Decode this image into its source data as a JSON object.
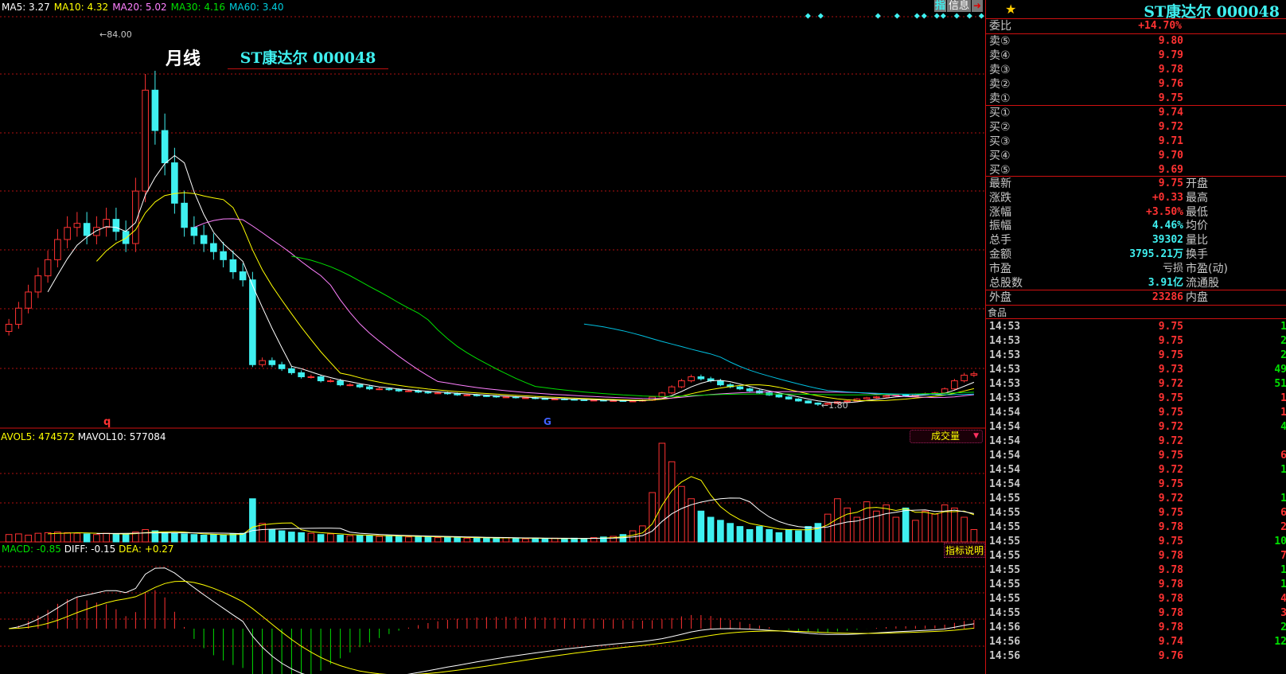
{
  "header": {
    "ma_labels": [
      {
        "text": "MA5: 3.27",
        "color": "#ffffff"
      },
      {
        "text": "MA10: 4.32",
        "color": "#ffff00"
      },
      {
        "text": "MA20: 5.02",
        "color": "#ff80ff"
      },
      {
        "text": "MA30: 4.16",
        "color": "#00e000"
      },
      {
        "text": "MA60: 3.40",
        "color": "#00d0e0"
      }
    ],
    "btn_zhi": "指",
    "btn_info": "信息"
  },
  "chart_title": {
    "period": "月线",
    "stock": "ST康达尔 000048"
  },
  "high_label": "84.00",
  "low_label": "1.80",
  "marker_q": "q",
  "marker_g": "G",
  "volume": {
    "avol5": "AVOL5: 474572",
    "mavol10": "MAVOL10: 577084",
    "selector": "成交量"
  },
  "macd": {
    "macd": "MACD: -0.85",
    "diff": "DIFF: -0.15",
    "dea": "DEA: +0.27",
    "help": "指标说明"
  },
  "quote": {
    "title": "ST康达尔 000048",
    "weibi": {
      "label": "委比",
      "value": "+14.70%"
    },
    "sell": [
      {
        "label": "卖⑤",
        "value": "9.80"
      },
      {
        "label": "卖④",
        "value": "9.79"
      },
      {
        "label": "卖③",
        "value": "9.78"
      },
      {
        "label": "卖②",
        "value": "9.76"
      },
      {
        "label": "卖①",
        "value": "9.75"
      }
    ],
    "buy": [
      {
        "label": "买①",
        "value": "9.74"
      },
      {
        "label": "买②",
        "value": "9.72"
      },
      {
        "label": "买③",
        "value": "9.71"
      },
      {
        "label": "买④",
        "value": "9.70"
      },
      {
        "label": "买⑤",
        "value": "9.69"
      }
    ],
    "stats": [
      {
        "label": "最新",
        "value": "9.75",
        "color": "red",
        "label2": "开盘"
      },
      {
        "label": "涨跌",
        "value": "+0.33",
        "color": "red",
        "label2": "最高"
      },
      {
        "label": "涨幅",
        "value": "+3.50%",
        "color": "red",
        "label2": "最低"
      },
      {
        "label": "振幅",
        "value": "4.46%",
        "color": "cyan",
        "label2": "均价"
      },
      {
        "label": "总手",
        "value": "39302",
        "color": "cyan",
        "label2": "量比"
      },
      {
        "label": "金额",
        "value": "3795.21万",
        "color": "cyan",
        "label2": "换手"
      },
      {
        "label": "市盈",
        "value": "亏损",
        "color": "grey",
        "label2": "市盈(动)"
      },
      {
        "label": "总股数",
        "value": "3.91亿",
        "color": "cyan",
        "label2": "流通股"
      }
    ],
    "outer": {
      "label": "外盘",
      "value": "23286",
      "label2": "内盘"
    },
    "sector": "食品",
    "ticks": [
      {
        "time": "14:53",
        "price": "9.75",
        "vol": "1",
        "c": "green"
      },
      {
        "time": "14:53",
        "price": "9.75",
        "vol": "2",
        "c": "green"
      },
      {
        "time": "14:53",
        "price": "9.75",
        "vol": "2",
        "c": "green"
      },
      {
        "time": "14:53",
        "price": "9.73",
        "vol": "49",
        "c": "green"
      },
      {
        "time": "14:53",
        "price": "9.72",
        "vol": "51",
        "c": "green"
      },
      {
        "time": "14:53",
        "price": "9.75",
        "vol": "1",
        "c": "red"
      },
      {
        "time": "14:54",
        "price": "9.75",
        "vol": "1",
        "c": "red"
      },
      {
        "time": "14:54",
        "price": "9.72",
        "vol": "4",
        "c": "green"
      },
      {
        "time": "14:54",
        "price": "9.72",
        "vol": "",
        "c": "green"
      },
      {
        "time": "14:54",
        "price": "9.75",
        "vol": "6",
        "c": "red"
      },
      {
        "time": "14:54",
        "price": "9.72",
        "vol": "1",
        "c": "green"
      },
      {
        "time": "14:54",
        "price": "9.75",
        "vol": "",
        "c": "red"
      },
      {
        "time": "14:55",
        "price": "9.72",
        "vol": "1",
        "c": "green"
      },
      {
        "time": "14:55",
        "price": "9.75",
        "vol": "6",
        "c": "red"
      },
      {
        "time": "14:55",
        "price": "9.78",
        "vol": "2",
        "c": "red"
      },
      {
        "time": "14:55",
        "price": "9.75",
        "vol": "10",
        "c": "green"
      },
      {
        "time": "14:55",
        "price": "9.78",
        "vol": "7",
        "c": "red"
      },
      {
        "time": "14:55",
        "price": "9.78",
        "vol": "1",
        "c": "green"
      },
      {
        "time": "14:55",
        "price": "9.78",
        "vol": "1",
        "c": "green"
      },
      {
        "time": "14:55",
        "price": "9.78",
        "vol": "4",
        "c": "red"
      },
      {
        "time": "14:55",
        "price": "9.78",
        "vol": "3",
        "c": "red"
      },
      {
        "time": "14:56",
        "price": "9.78",
        "vol": "2",
        "c": "green"
      },
      {
        "time": "14:56",
        "price": "9.74",
        "vol": "12",
        "c": "green"
      },
      {
        "time": "14:56",
        "price": "9.76",
        "vol": "",
        "c": "green"
      }
    ]
  },
  "colors": {
    "up": "#ff3232",
    "down": "#3ff0f0",
    "grid": "#b01010",
    "ma5": "#ffffff",
    "ma10": "#ffff00",
    "ma20": "#ff80ff",
    "ma30": "#00e000",
    "ma60": "#00c0e0"
  },
  "chart_data": {
    "type": "candlestick",
    "period": "monthly",
    "price_range": [
      1.8,
      84.0
    ],
    "closes": [
      22,
      26,
      30,
      34,
      38,
      43,
      46,
      47,
      44,
      46,
      48,
      45,
      42,
      55,
      80,
      70,
      62,
      52,
      46,
      44,
      42,
      40,
      38,
      35,
      33,
      12,
      13,
      12,
      11,
      10,
      9,
      9,
      8,
      8,
      7,
      7,
      6.5,
      6,
      6,
      5.8,
      5.5,
      5.5,
      5.2,
      5,
      5,
      4.8,
      4.5,
      4.5,
      4.3,
      4.2,
      4,
      4,
      3.8,
      3.8,
      3.6,
      3.5,
      3.5,
      3.4,
      3.3,
      3.2,
      3.2,
      3.1,
      3.1,
      3,
      3,
      3.2,
      4,
      5,
      6.5,
      8,
      9,
      8.5,
      8,
      7,
      6.5,
      6,
      5.5,
      5,
      4.5,
      4,
      3.5,
      3,
      2.5,
      2.2,
      2.4,
      2.8,
      3,
      3.5,
      3.8,
      4,
      4.3,
      4.5,
      4.2,
      4.6,
      4.8,
      5,
      6,
      8,
      9.4,
      9.75
    ],
    "high_index": 14,
    "high_value": 84.0,
    "low_index": 83,
    "low_value": 1.8,
    "volumes": [
      120,
      130,
      110,
      140,
      150,
      160,
      150,
      140,
      130,
      120,
      140,
      130,
      120,
      160,
      200,
      180,
      150,
      140,
      130,
      120,
      110,
      120,
      110,
      130,
      140,
      700,
      300,
      200,
      180,
      160,
      150,
      140,
      120,
      130,
      110,
      100,
      110,
      100,
      90,
      100,
      90,
      80,
      90,
      80,
      70,
      80,
      70,
      60,
      70,
      60,
      60,
      70,
      60,
      50,
      60,
      50,
      60,
      50,
      60,
      50,
      70,
      80,
      90,
      120,
      180,
      260,
      800,
      1600,
      1300,
      900,
      700,
      500,
      400,
      350,
      300,
      250,
      200,
      250,
      200,
      150,
      200,
      180,
      250,
      300,
      450,
      700,
      550,
      400,
      650,
      500,
      600,
      400,
      550,
      350,
      500,
      450,
      600,
      550,
      400,
      200
    ]
  }
}
